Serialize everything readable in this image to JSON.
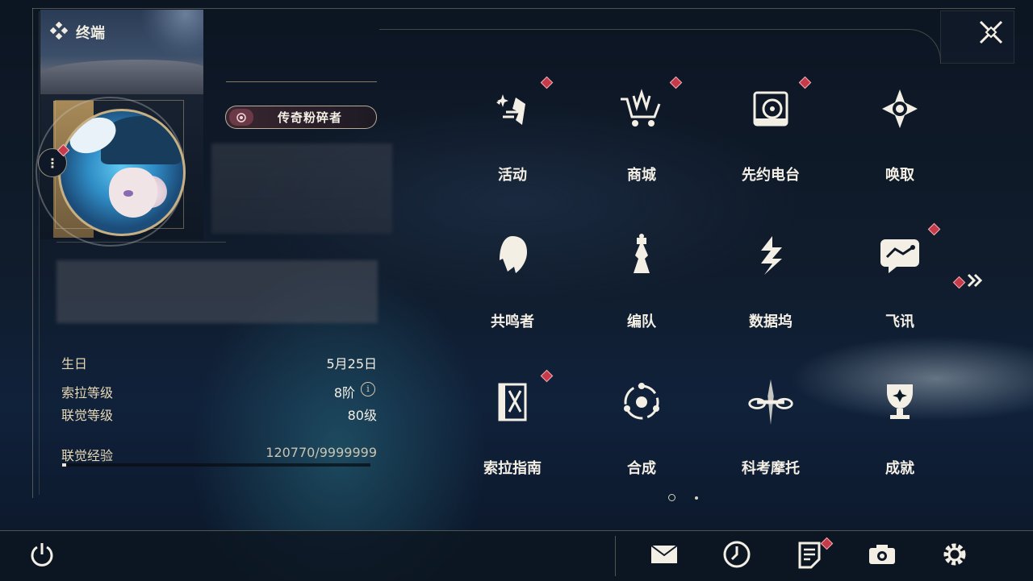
{
  "header": {
    "title": "终端"
  },
  "profile": {
    "title_badge": "传奇粉碎者",
    "fields": [
      {
        "label": "生日",
        "value": "5月25日"
      },
      {
        "label": "索拉等级",
        "value": "8阶"
      },
      {
        "label": "联觉等级",
        "value": "80级"
      }
    ],
    "experience": {
      "label": "联觉经验",
      "value": "120770/9999999",
      "current": 120770,
      "max": 9999999
    }
  },
  "menu": {
    "items": [
      {
        "label": "活动",
        "icon": "events-icon",
        "badge": true
      },
      {
        "label": "商城",
        "icon": "shop-icon",
        "badge": true
      },
      {
        "label": "先约电台",
        "icon": "radio-icon",
        "badge": true
      },
      {
        "label": "唤取",
        "icon": "convene-icon",
        "badge": false
      },
      {
        "label": "共鸣者",
        "icon": "resonator-icon",
        "badge": false
      },
      {
        "label": "编队",
        "icon": "team-icon",
        "badge": false
      },
      {
        "label": "数据坞",
        "icon": "data-bank-icon",
        "badge": false
      },
      {
        "label": "飞讯",
        "icon": "message-icon",
        "badge": true
      },
      {
        "label": "索拉指南",
        "icon": "guide-icon",
        "badge": true
      },
      {
        "label": "合成",
        "icon": "synthesis-icon",
        "badge": false
      },
      {
        "label": "科考摩托",
        "icon": "motorcycle-icon",
        "badge": false
      },
      {
        "label": "成就",
        "icon": "achievement-icon",
        "badge": false
      }
    ],
    "pagination": {
      "current_page": 1,
      "total_pages": 2
    }
  },
  "bottom_bar": {
    "left": [
      "power-icon"
    ],
    "right": [
      "mail-icon",
      "clock-icon",
      "notice-icon",
      "camera-icon",
      "settings-icon"
    ]
  },
  "colors": {
    "accent_gold": "#d9c9a0",
    "badge_red": "#c73a4a",
    "text": "#f3efe4",
    "label": "#e7d9b5"
  }
}
